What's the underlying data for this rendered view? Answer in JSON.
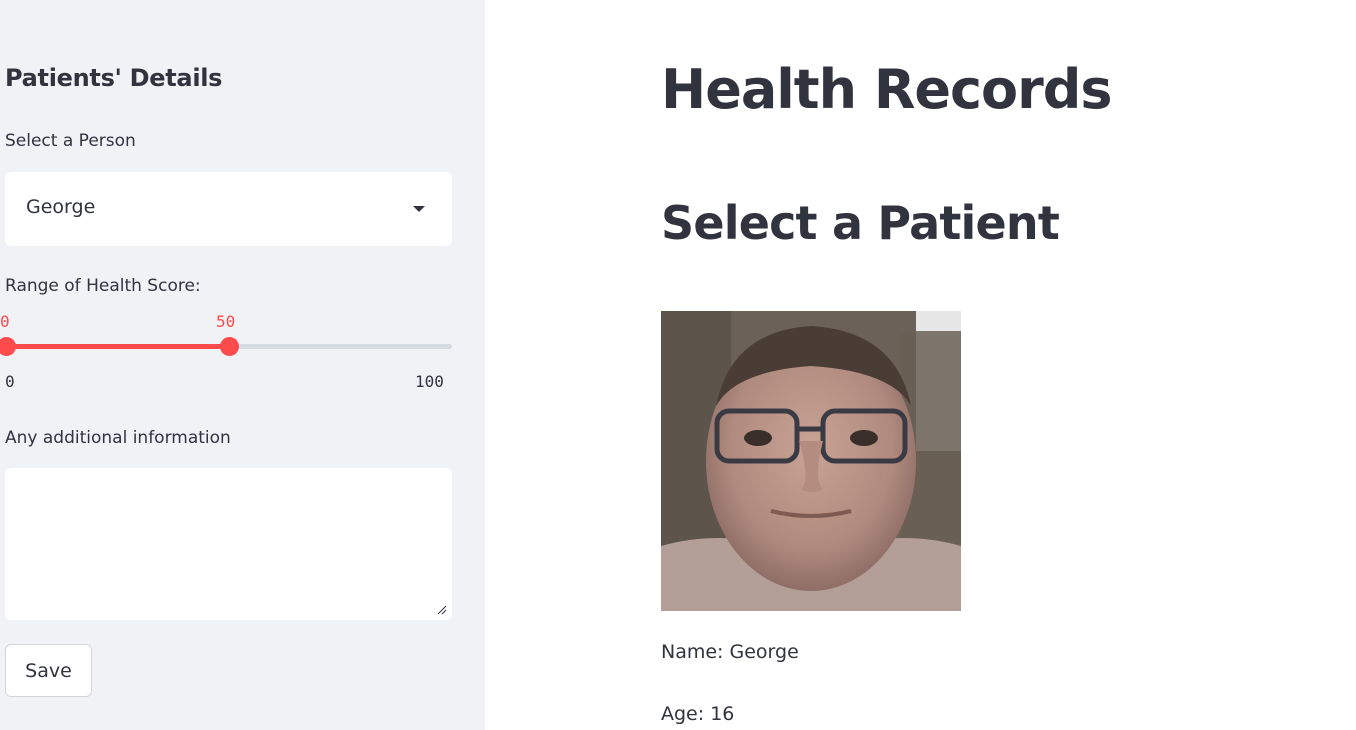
{
  "sidebar": {
    "title": "Patients' Details",
    "select_label": "Select a Person",
    "select_value": "George",
    "slider_label": "Range of Health Score:",
    "slider_low": "0",
    "slider_high": "50",
    "slider_min": "0",
    "slider_max": "100",
    "slider_low_fraction": 0.0,
    "slider_high_fraction": 0.5,
    "textarea_label": "Any additional information",
    "textarea_value": "",
    "save_label": "Save"
  },
  "main": {
    "title": "Health Records",
    "subtitle": "Select a Patient",
    "name_line": "Name: George",
    "age_line": "Age: 16"
  },
  "colors": {
    "accent": "#ff4b4b",
    "sidebar_bg": "#f0f2f6",
    "text": "#31333f"
  }
}
